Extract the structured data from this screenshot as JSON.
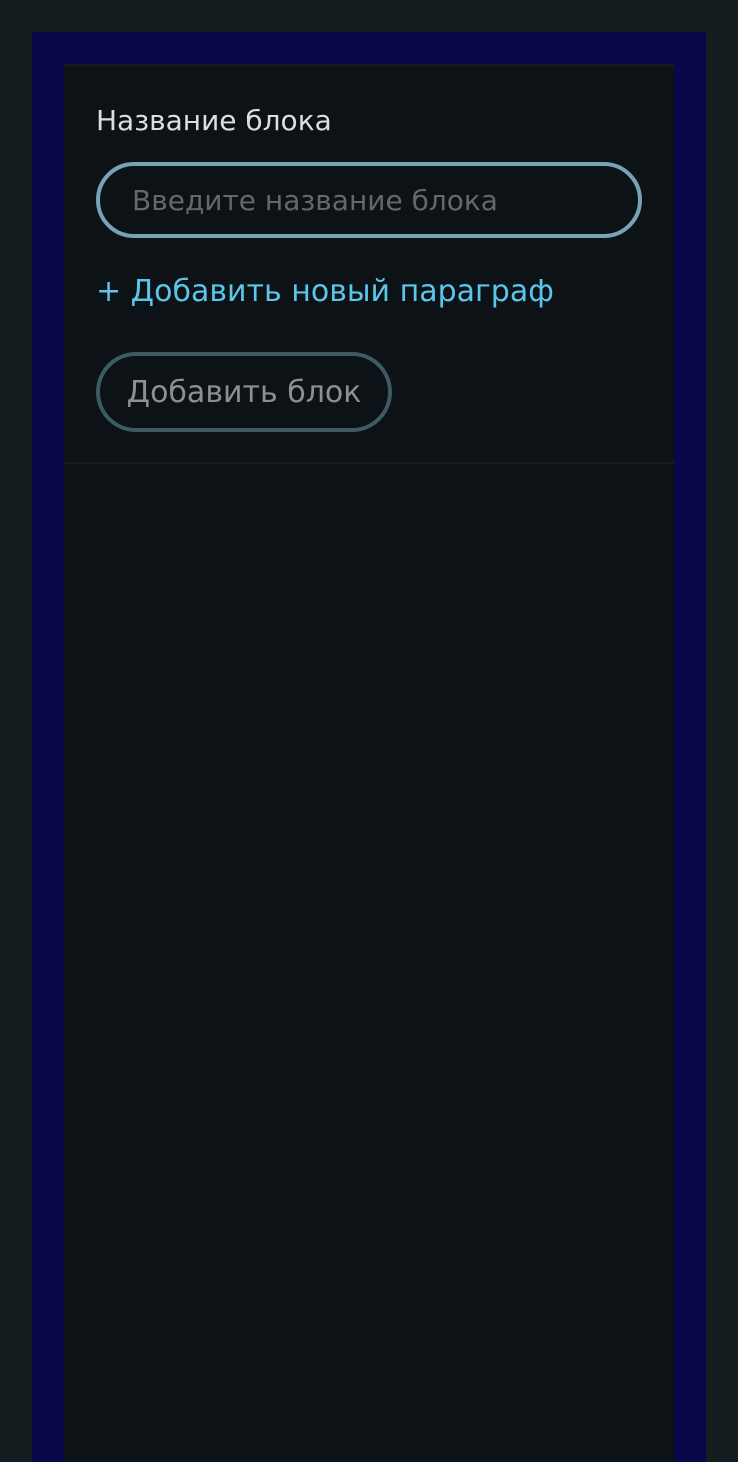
{
  "form": {
    "label": "Название блока",
    "name_input": {
      "placeholder": "Введите название блока",
      "value": ""
    },
    "add_paragraph_label": "+ Добавить новый параграф",
    "add_block_label": "Добавить блок"
  },
  "colors": {
    "accent": "#5bc5ea",
    "input_border": "#76a3b6",
    "frame": "#0b0849"
  }
}
